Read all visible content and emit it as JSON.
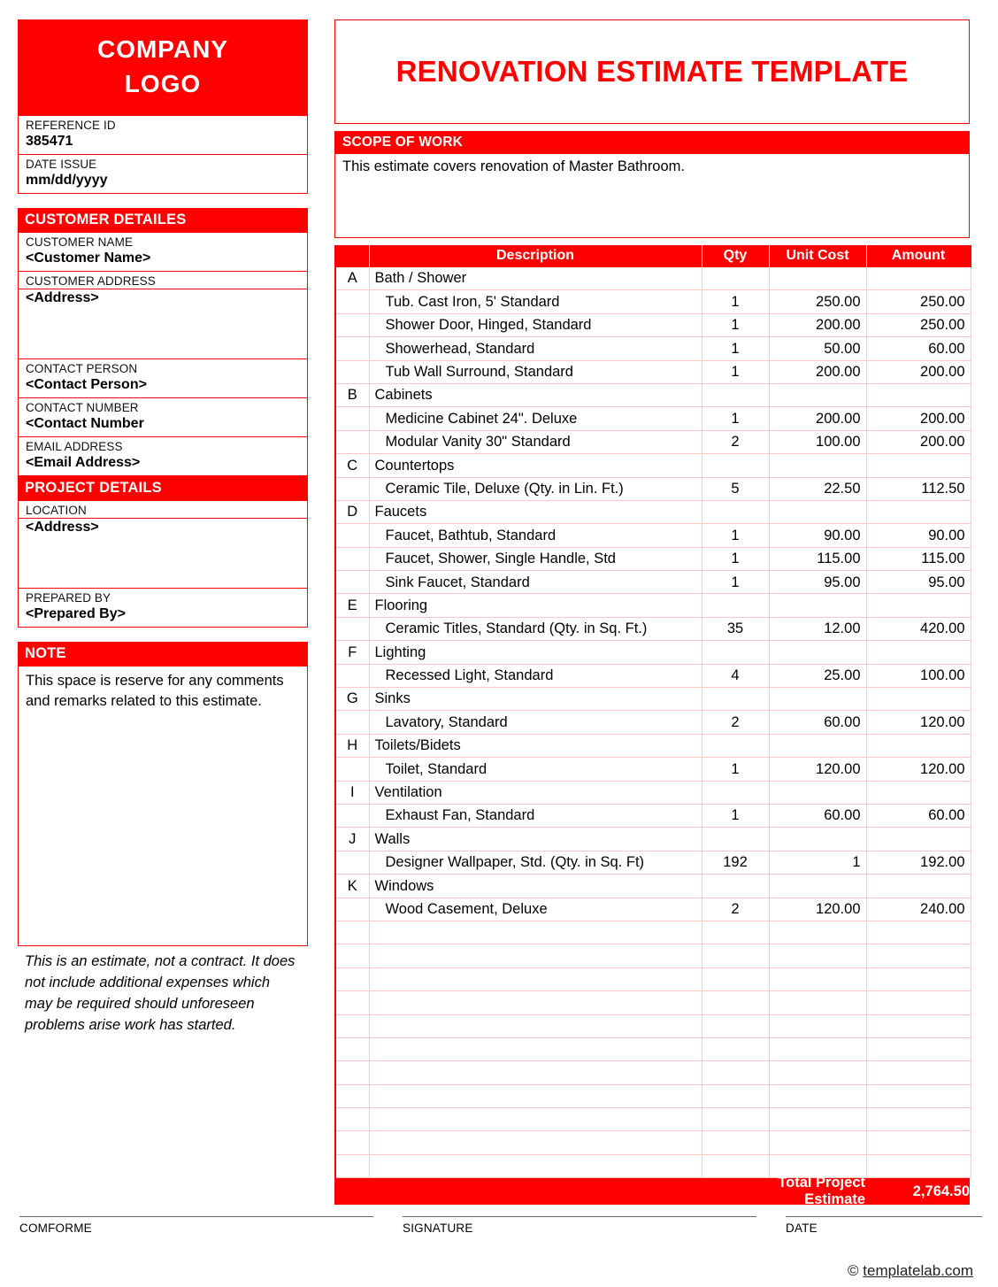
{
  "company": {
    "logo_line1": "COMPANY",
    "logo_line2": "LOGO"
  },
  "reference": {
    "id_label": "REFERENCE ID",
    "id_value": "385471",
    "date_label": "DATE ISSUE",
    "date_value": "mm/dd/yyyy"
  },
  "customer": {
    "section_title": "CUSTOMER DETAILES",
    "name_label": "CUSTOMER NAME",
    "name_value": "<Customer Name>",
    "address_label": "CUSTOMER ADDRESS",
    "address_value": "<Address>",
    "contact_person_label": "CONTACT PERSON",
    "contact_person_value": "<Contact Person>",
    "contact_number_label": "CONTACT NUMBER",
    "contact_number_value": "<Contact Number",
    "email_label": "EMAIL ADDRESS",
    "email_value": "<Email Address>"
  },
  "project": {
    "section_title": "PROJECT DETAILS",
    "location_label": "LOCATION",
    "location_value": "<Address>",
    "prepared_by_label": "PREPARED BY",
    "prepared_by_value": "<Prepared By>"
  },
  "note": {
    "section_title": "NOTE",
    "body": "This space is reserve for any comments and remarks related to this estimate.",
    "disclaimer": "This is an estimate, not a contract. It does not include additional expenses which may be required should unforeseen problems arise work has started."
  },
  "main": {
    "title": "RENOVATION ESTIMATE TEMPLATE",
    "scope_title": "SCOPE OF WORK",
    "scope_body": "This estimate covers renovation of Master Bathroom."
  },
  "table": {
    "headers": {
      "letter": "",
      "description": "Description",
      "qty": "Qty",
      "unit_cost": "Unit Cost",
      "amount": "Amount"
    },
    "rows": [
      {
        "letter": "A",
        "description": "Bath / Shower",
        "qty": "",
        "unit_cost": "",
        "amount": "",
        "category": true
      },
      {
        "letter": "",
        "description": "Tub. Cast Iron, 5' Standard",
        "qty": "1",
        "unit_cost": "250.00",
        "amount": "250.00",
        "category": false
      },
      {
        "letter": "",
        "description": "Shower Door, Hinged, Standard",
        "qty": "1",
        "unit_cost": "200.00",
        "amount": "250.00",
        "category": false
      },
      {
        "letter": "",
        "description": "Showerhead, Standard",
        "qty": "1",
        "unit_cost": "50.00",
        "amount": "60.00",
        "category": false
      },
      {
        "letter": "",
        "description": "Tub Wall Surround, Standard",
        "qty": "1",
        "unit_cost": "200.00",
        "amount": "200.00",
        "category": false
      },
      {
        "letter": "B",
        "description": "Cabinets",
        "qty": "",
        "unit_cost": "",
        "amount": "",
        "category": true
      },
      {
        "letter": "",
        "description": "Medicine Cabinet 24\". Deluxe",
        "qty": "1",
        "unit_cost": "200.00",
        "amount": "200.00",
        "category": false
      },
      {
        "letter": "",
        "description": "Modular Vanity 30\" Standard",
        "qty": "2",
        "unit_cost": "100.00",
        "amount": "200.00",
        "category": false
      },
      {
        "letter": "C",
        "description": "Countertops",
        "qty": "",
        "unit_cost": "",
        "amount": "",
        "category": true
      },
      {
        "letter": "",
        "description": "Ceramic Tile, Deluxe (Qty. in Lin. Ft.)",
        "qty": "5",
        "unit_cost": "22.50",
        "amount": "112.50",
        "category": false
      },
      {
        "letter": "D",
        "description": "Faucets",
        "qty": "",
        "unit_cost": "",
        "amount": "",
        "category": true
      },
      {
        "letter": "",
        "description": "Faucet, Bathtub, Standard",
        "qty": "1",
        "unit_cost": "90.00",
        "amount": "90.00",
        "category": false
      },
      {
        "letter": "",
        "description": "Faucet, Shower, Single Handle, Std",
        "qty": "1",
        "unit_cost": "115.00",
        "amount": "115.00",
        "category": false
      },
      {
        "letter": "",
        "description": "Sink Faucet, Standard",
        "qty": "1",
        "unit_cost": "95.00",
        "amount": "95.00",
        "category": false
      },
      {
        "letter": "E",
        "description": "Flooring",
        "qty": "",
        "unit_cost": "",
        "amount": "",
        "category": true
      },
      {
        "letter": "",
        "description": "Ceramic Titles, Standard (Qty. in Sq. Ft.)",
        "qty": "35",
        "unit_cost": "12.00",
        "amount": "420.00",
        "category": false
      },
      {
        "letter": "F",
        "description": "Lighting",
        "qty": "",
        "unit_cost": "",
        "amount": "",
        "category": true
      },
      {
        "letter": "",
        "description": "Recessed Light, Standard",
        "qty": "4",
        "unit_cost": "25.00",
        "amount": "100.00",
        "category": false
      },
      {
        "letter": "G",
        "description": "Sinks",
        "qty": "",
        "unit_cost": "",
        "amount": "",
        "category": true
      },
      {
        "letter": "",
        "description": "Lavatory, Standard",
        "qty": "2",
        "unit_cost": "60.00",
        "amount": "120.00",
        "category": false
      },
      {
        "letter": "H",
        "description": "Toilets/Bidets",
        "qty": "",
        "unit_cost": "",
        "amount": "",
        "category": true
      },
      {
        "letter": "",
        "description": "Toilet, Standard",
        "qty": "1",
        "unit_cost": "120.00",
        "amount": "120.00",
        "category": false
      },
      {
        "letter": "I",
        "description": "Ventilation",
        "qty": "",
        "unit_cost": "",
        "amount": "",
        "category": true
      },
      {
        "letter": "",
        "description": "Exhaust Fan, Standard",
        "qty": "1",
        "unit_cost": "60.00",
        "amount": "60.00",
        "category": false
      },
      {
        "letter": "J",
        "description": "Walls",
        "qty": "",
        "unit_cost": "",
        "amount": "",
        "category": true
      },
      {
        "letter": "",
        "description": "Designer Wallpaper, Std. (Qty. in Sq. Ft)",
        "qty": "192",
        "unit_cost": "1",
        "amount": "192.00",
        "category": false
      },
      {
        "letter": "K",
        "description": "Windows",
        "qty": "",
        "unit_cost": "",
        "amount": "",
        "category": true
      },
      {
        "letter": "",
        "description": "Wood Casement, Deluxe",
        "qty": "2",
        "unit_cost": "120.00",
        "amount": "240.00",
        "category": false
      },
      {
        "letter": "",
        "description": "",
        "qty": "",
        "unit_cost": "",
        "amount": "",
        "category": false
      },
      {
        "letter": "",
        "description": "",
        "qty": "",
        "unit_cost": "",
        "amount": "",
        "category": false
      },
      {
        "letter": "",
        "description": "",
        "qty": "",
        "unit_cost": "",
        "amount": "",
        "category": false
      },
      {
        "letter": "",
        "description": "",
        "qty": "",
        "unit_cost": "",
        "amount": "",
        "category": false
      },
      {
        "letter": "",
        "description": "",
        "qty": "",
        "unit_cost": "",
        "amount": "",
        "category": false
      },
      {
        "letter": "",
        "description": "",
        "qty": "",
        "unit_cost": "",
        "amount": "",
        "category": false
      },
      {
        "letter": "",
        "description": "",
        "qty": "",
        "unit_cost": "",
        "amount": "",
        "category": false
      },
      {
        "letter": "",
        "description": "",
        "qty": "",
        "unit_cost": "",
        "amount": "",
        "category": false
      },
      {
        "letter": "",
        "description": "",
        "qty": "",
        "unit_cost": "",
        "amount": "",
        "category": false
      },
      {
        "letter": "",
        "description": "",
        "qty": "",
        "unit_cost": "",
        "amount": "",
        "category": false
      },
      {
        "letter": "",
        "description": "",
        "qty": "",
        "unit_cost": "",
        "amount": "",
        "category": false
      }
    ],
    "total_label": "Total Project Estimate",
    "total_value": "2,764.50"
  },
  "footer": {
    "comforme_label": "COMFORME",
    "signature_label": "SIGNATURE",
    "date_label": "DATE",
    "credit_symbol": "©",
    "credit_text": "templatelab.com"
  },
  "colors": {
    "brand_red": "#FF0000",
    "grid_pink": "#FBC7C7",
    "text": "#000000"
  }
}
